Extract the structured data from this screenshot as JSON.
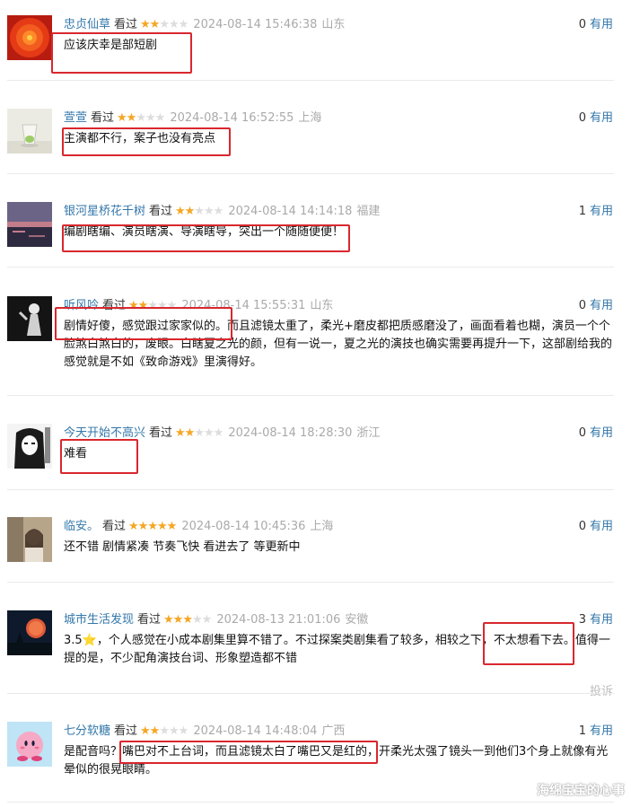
{
  "vote_label": "有用",
  "watched_label": "看过",
  "colors": {
    "username": "#3377aa",
    "highlight_box": "#d9272e",
    "star_filled": "#f5a623",
    "star_empty": "#dddddd"
  },
  "comments": [
    {
      "user": "忠贞仙草",
      "rating": 2,
      "timestamp": "2024-08-14 15:46:38",
      "location": "山东",
      "votes": "0",
      "text": "应该庆幸是部短剧",
      "avatar_icon": "red-flower-avatar"
    },
    {
      "user": "萱萱",
      "rating": 2,
      "timestamp": "2024-08-14 16:52:55",
      "location": "上海",
      "votes": "0",
      "text": "主演都不行，案子也没有亮点",
      "avatar_icon": "glass-cup-avatar"
    },
    {
      "user": "银河星桥花千树",
      "rating": 2,
      "timestamp": "2024-08-14 14:14:18",
      "location": "福建",
      "votes": "1",
      "text": "编剧瞎编、演员瞎演、导演瞎导，突出一个随随便便！",
      "avatar_icon": "sunset-sea-avatar"
    },
    {
      "user": "听风吟",
      "rating": 2,
      "timestamp": "2024-08-14 15:55:31",
      "location": "山东",
      "votes": "0",
      "text": "剧情好傻，感觉跟过家家似的。而且滤镜太重了，柔光+磨皮都把质感磨没了，画面看着也糊，演员一个个脸煞白煞白的，废眼。白瞎夏之光的颜，但有一说一，夏之光的演技也确实需要再提升一下，这部剧给我的感觉就是不如《致命游戏》里演得好。",
      "avatar_icon": "dark-figure-avatar"
    },
    {
      "user": "今天开始不高兴",
      "rating": 2,
      "timestamp": "2024-08-14 18:28:30",
      "location": "浙江",
      "votes": "0",
      "text": "难看",
      "avatar_icon": "manga-girl-avatar"
    },
    {
      "user": "临安。",
      "rating": 5,
      "timestamp": "2024-08-14 10:45:36",
      "location": "上海",
      "votes": "0",
      "text": "还不错 剧情紧凑 节奏飞快 看进去了 等更新中",
      "avatar_icon": "girl-photo-avatar"
    },
    {
      "user": "城市生活发现",
      "rating": 3,
      "timestamp": "2024-08-13 21:01:06",
      "location": "安徽",
      "votes": "3",
      "text": "3.5⭐，个人感觉在小成本剧集里算不错了。不过探案类剧集看了较多，相较之下，不太想看下去。值得一提的是，不少配角演技台词、形象塑造都不错",
      "avatar_icon": "night-moon-avatar",
      "report_label": "投诉"
    },
    {
      "user": "七分软糖",
      "rating": 2,
      "timestamp": "2024-08-14 14:48:04",
      "location": "广西",
      "votes": "1",
      "text": "是配音吗？嘴巴对不上台词，而且滤镜太白了嘴巴又是红的，开柔光太强了镜头一到他们3个身上就像有光晕似的很晃眼睛。",
      "avatar_icon": "pink-kirby-avatar"
    }
  ],
  "watermark": "海绵宝宝的心事"
}
